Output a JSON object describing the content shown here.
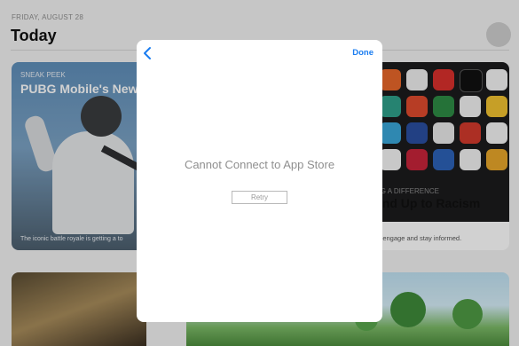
{
  "header": {
    "date": "FRIDAY, AUGUST 28",
    "title": "Today"
  },
  "cards": {
    "pubg": {
      "eyebrow": "SNEAK PEEK",
      "headline": "PUBG Mobile's New",
      "caption": "The iconic battle royale is getting a to"
    },
    "racism": {
      "eyebrow": "NG A DIFFERENCE",
      "headline": "and Up to Racism",
      "caption": "to engage and stay informed."
    }
  },
  "modal": {
    "done_label": "Done",
    "message": "Cannot Connect to App Store",
    "retry_label": "Retry"
  },
  "colors": {
    "accent": "#1a7cf0",
    "message_text": "#8f8f8f"
  }
}
